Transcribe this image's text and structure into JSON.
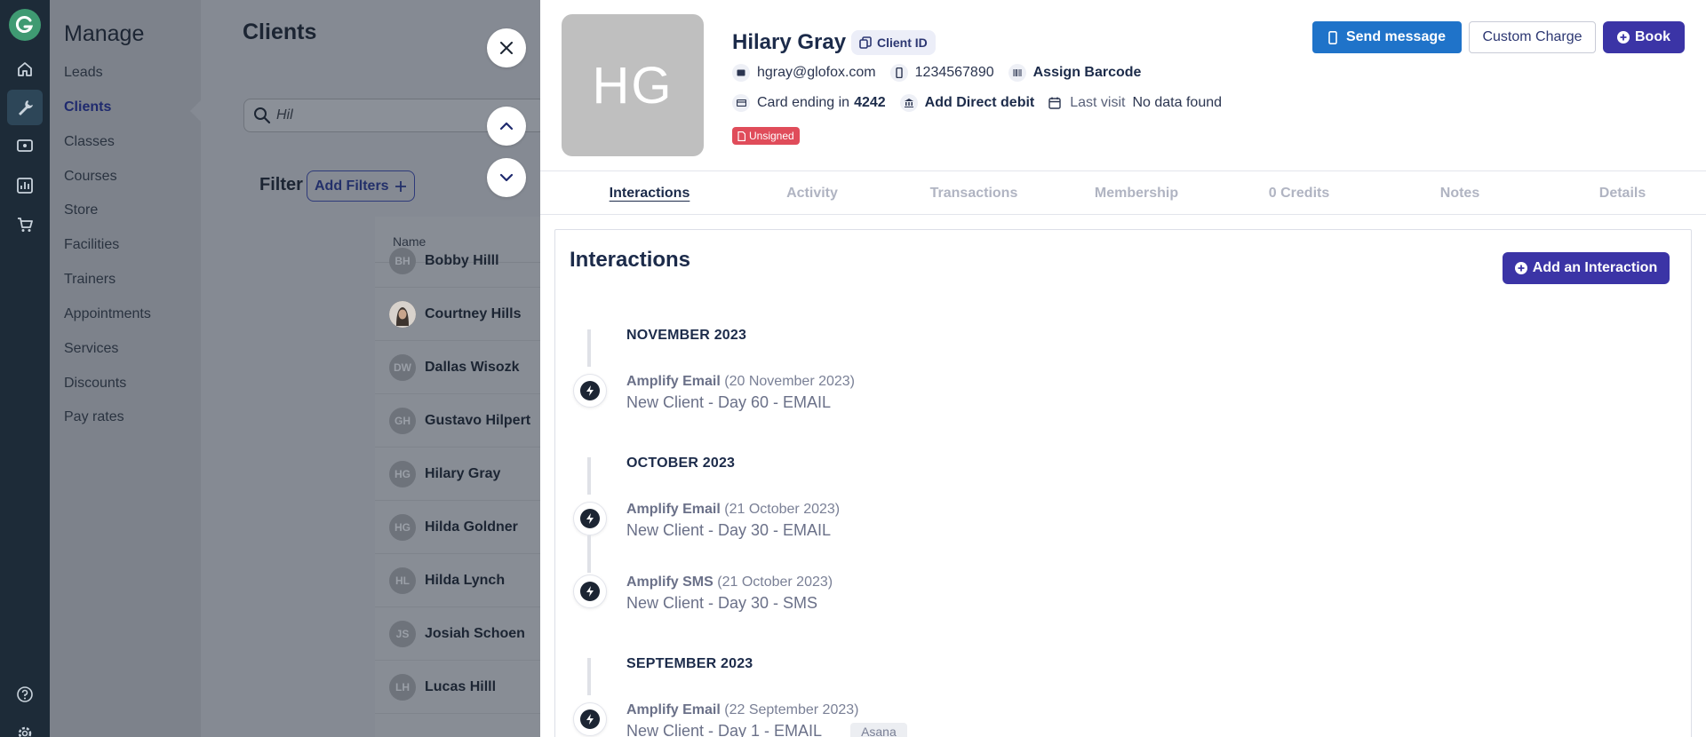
{
  "nav": {
    "logo_icon": "glofox-logo",
    "icons": [
      "home-icon",
      "wrench-icon",
      "message-icon",
      "chart-icon",
      "cart-icon",
      "help-icon",
      "settings-icon"
    ]
  },
  "menu": {
    "title": "Manage",
    "items": [
      "Leads",
      "Clients",
      "Classes",
      "Courses",
      "Store",
      "Facilities",
      "Trainers",
      "Appointments",
      "Services",
      "Discounts",
      "Pay rates"
    ],
    "active": "Clients"
  },
  "clients": {
    "title": "Clients",
    "search_value": "Hil",
    "filter_label": "Filter",
    "add_filters_label": "Add Filters",
    "column_name": "Name",
    "rows": [
      {
        "initials": "BH",
        "name": "Bobby Hilll"
      },
      {
        "initials": "",
        "name": "Courtney Hills"
      },
      {
        "initials": "DW",
        "name": "Dallas Wisozk"
      },
      {
        "initials": "GH",
        "name": "Gustavo Hilpert"
      },
      {
        "initials": "HG",
        "name": "Hilary Gray"
      },
      {
        "initials": "HG",
        "name": "Hilda Goldner"
      },
      {
        "initials": "HL",
        "name": "Hilda Lynch"
      },
      {
        "initials": "JS",
        "name": "Josiah Schoen"
      },
      {
        "initials": "LH",
        "name": "Lucas Hilll"
      }
    ]
  },
  "profile": {
    "initials": "HG",
    "name": "Hilary Gray",
    "client_id_label": "Client ID",
    "email": "hgray@glofox.com",
    "phone": "1234567890",
    "barcode_label": "Assign Barcode",
    "card_prefix": "Card ending in",
    "card_last4": "4242",
    "direct_debit_label": "Add Direct debit",
    "last_visit_label": "Last visit",
    "last_visit_value": "No data found",
    "unsigned_badge": "Unsigned",
    "actions": {
      "send_message": "Send message",
      "custom_charge": "Custom Charge",
      "book": "Book"
    },
    "colors": {
      "primary": "#3b34a6",
      "send": "#1f73c9",
      "unsigned": "#e04c5a"
    }
  },
  "tabs": [
    "Interactions",
    "Activity",
    "Transactions",
    "Membership",
    "0 Credits",
    "Notes",
    "Details"
  ],
  "active_tab": "Interactions",
  "interactions": {
    "title": "Interactions",
    "add_label": "Add an Interaction",
    "months": [
      {
        "label": "NOVEMBER 2023",
        "entries": [
          {
            "type": "Amplify Email",
            "date": "(20 November 2023)",
            "subject": "New Client - Day 60 - EMAIL"
          }
        ]
      },
      {
        "label": "OCTOBER 2023",
        "entries": [
          {
            "type": "Amplify Email",
            "date": "(21 October 2023)",
            "subject": "New Client - Day 30 - EMAIL"
          },
          {
            "type": "Amplify SMS",
            "date": "(21 October 2023)",
            "subject": "New Client - Day 30 - SMS"
          }
        ]
      },
      {
        "label": "SEPTEMBER 2023",
        "entries": [
          {
            "type": "Amplify Email",
            "date": "(22 September 2023)",
            "subject": "New Client - Day 1 - EMAIL",
            "tag": "Asana"
          }
        ]
      }
    ]
  }
}
